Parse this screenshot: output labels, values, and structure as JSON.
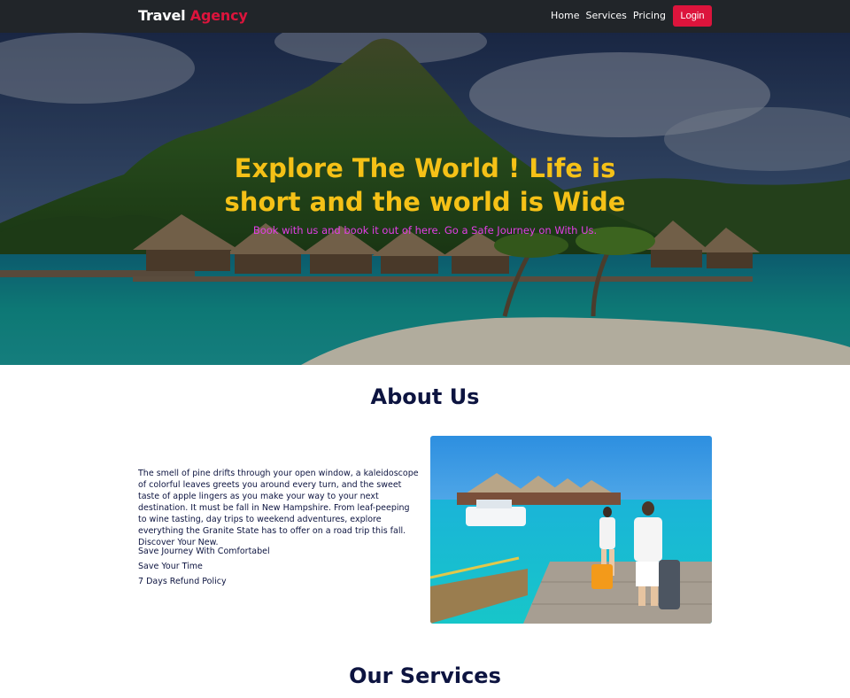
{
  "navbar": {
    "brand_main": "Travel",
    "brand_accent": "Agency",
    "links": [
      "Home",
      "Services",
      "Pricing"
    ],
    "login_label": "Login",
    "colors": {
      "background": "#212529",
      "accent": "#dc143c"
    }
  },
  "hero": {
    "title_line1": "Explore The World ! Life is",
    "title_line2": "short and the world is Wide",
    "subtitle": "Book with us and book it out of here. Go a Safe Journey on With Us.",
    "colors": {
      "title": "#f5c117",
      "subtitle": "#e23ee6"
    }
  },
  "about": {
    "title": "About Us",
    "paragraph": "The smell of pine drifts through your open window, a kaleidoscope of colorful leaves greets you around every turn, and the sweet taste of apple lingers as you make your way to your next destination. It must be fall in New Hampshire. From leaf-peeping to wine tasting, day trips to weekend adventures, explore everything the Granite State has to offer on a road trip this fall. Discover Your New.",
    "features": [
      "Save Journey With Comfortabel",
      "Save Your Time",
      "7 Days Refund Policy"
    ]
  },
  "services": {
    "title": "Our Services"
  }
}
